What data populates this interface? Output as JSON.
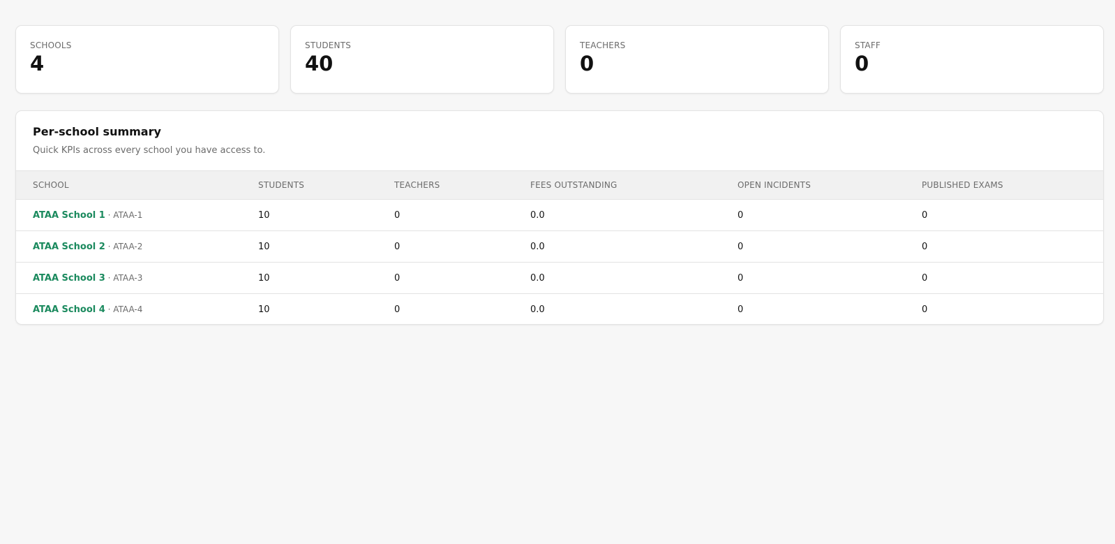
{
  "stats": [
    {
      "label": "SCHOOLS",
      "value": "4"
    },
    {
      "label": "STUDENTS",
      "value": "40"
    },
    {
      "label": "TEACHERS",
      "value": "0"
    },
    {
      "label": "STAFF",
      "value": "0"
    }
  ],
  "summary": {
    "title": "Per-school summary",
    "subtitle": "Quick KPIs across every school you have access to.",
    "columns": [
      "SCHOOL",
      "STUDENTS",
      "TEACHERS",
      "FEES OUTSTANDING",
      "OPEN INCIDENTS",
      "PUBLISHED EXAMS"
    ],
    "rows": [
      {
        "name": "ATAA School 1",
        "code": " · ATAA-1",
        "students": "10",
        "teachers": "0",
        "fees": "0.0",
        "incidents": "0",
        "exams": "0"
      },
      {
        "name": "ATAA School 2",
        "code": " · ATAA-2",
        "students": "10",
        "teachers": "0",
        "fees": "0.0",
        "incidents": "0",
        "exams": "0"
      },
      {
        "name": "ATAA School 3",
        "code": " · ATAA-3",
        "students": "10",
        "teachers": "0",
        "fees": "0.0",
        "incidents": "0",
        "exams": "0"
      },
      {
        "name": "ATAA School 4",
        "code": " · ATAA-4",
        "students": "10",
        "teachers": "0",
        "fees": "0.0",
        "incidents": "0",
        "exams": "0"
      }
    ]
  },
  "colors": {
    "accent": "#1b8a5e",
    "background": "#f7f7f7",
    "card": "#ffffff",
    "muted_text": "#6b6b6b"
  }
}
